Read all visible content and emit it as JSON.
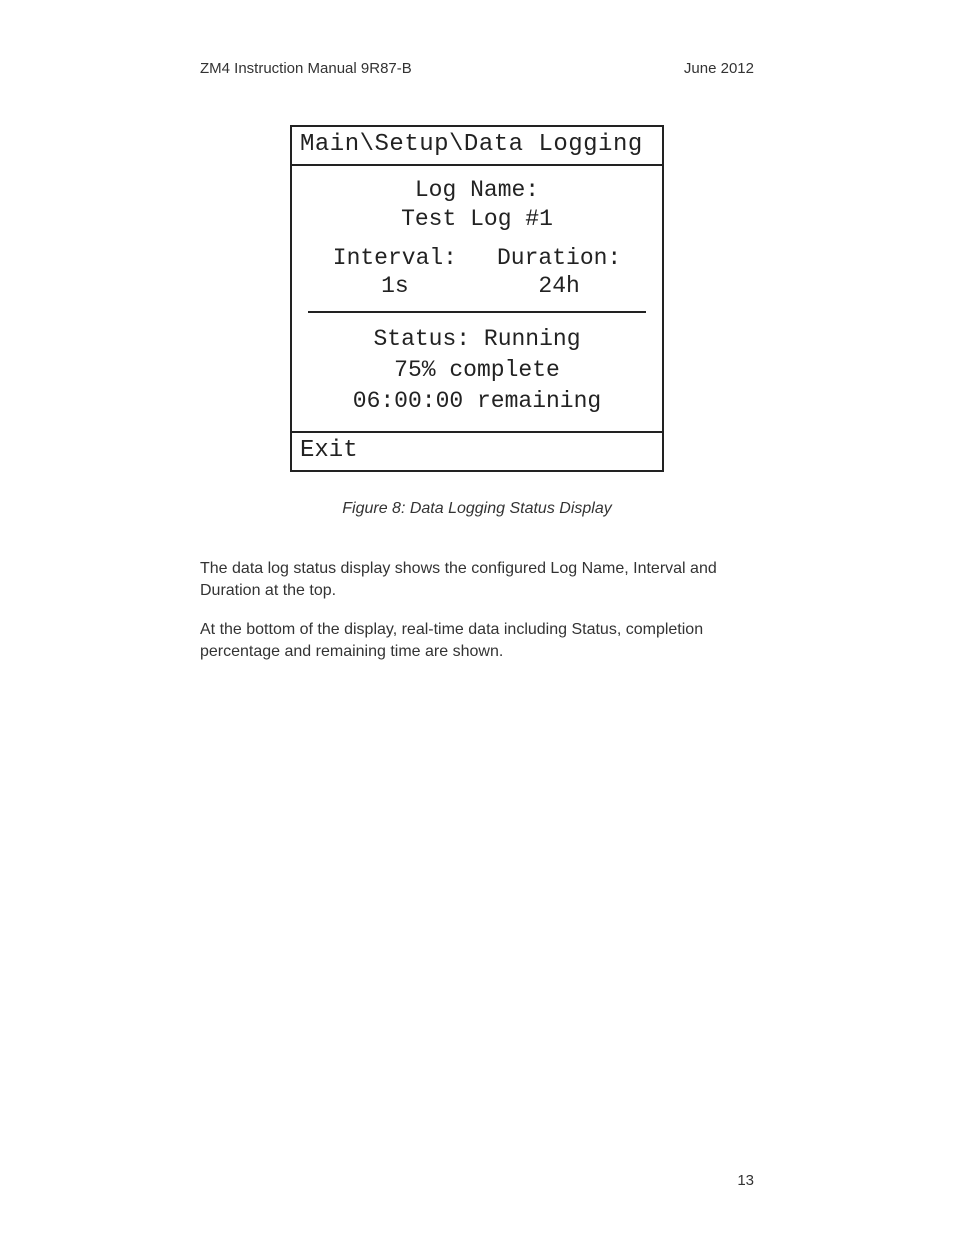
{
  "header": {
    "left": "ZM4    Instruction Manual 9R87-B",
    "right": "June 2012"
  },
  "lcd": {
    "breadcrumb": "Main\\Setup\\Data Logging",
    "log_name_label": "Log Name:",
    "log_name_value": "Test Log #1",
    "interval_label": "Interval:",
    "interval_value": "1s",
    "duration_label": "Duration:",
    "duration_value": "24h",
    "status_line": "Status: Running",
    "percent_line": "75% complete",
    "remaining_line": "06:00:00 remaining",
    "exit_label": "Exit"
  },
  "caption": "Figure 8: Data Logging Status Display",
  "paragraphs": {
    "p1": "The data log status display shows the configured Log Name, Interval and Duration at the top.",
    "p2": "At the bottom of the display, real-time data including Status, completion percentage and remaining time are shown."
  },
  "page_number": "13"
}
